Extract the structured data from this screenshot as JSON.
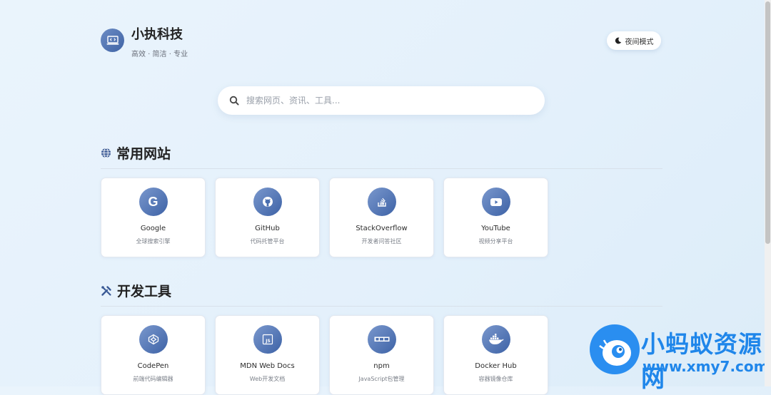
{
  "brand": {
    "title": "小执科技",
    "subtitle": "高效 · 简洁 · 专业"
  },
  "night_mode": {
    "label": "夜间模式"
  },
  "search": {
    "placeholder": "搜索网页、资讯、工具..."
  },
  "sections": [
    {
      "title": "常用网站",
      "icon": "globe-icon",
      "cards": [
        {
          "name": "Google",
          "desc": "全球搜索引擎",
          "icon": "google-icon"
        },
        {
          "name": "GitHub",
          "desc": "代码托管平台",
          "icon": "github-icon"
        },
        {
          "name": "StackOverflow",
          "desc": "开发者问答社区",
          "icon": "stackoverflow-icon"
        },
        {
          "name": "YouTube",
          "desc": "视频分享平台",
          "icon": "youtube-icon"
        }
      ]
    },
    {
      "title": "开发工具",
      "icon": "tools-icon",
      "cards": [
        {
          "name": "CodePen",
          "desc": "前端代码编辑器",
          "icon": "codepen-icon"
        },
        {
          "name": "MDN Web Docs",
          "desc": "Web开发文档",
          "icon": "js-icon"
        },
        {
          "name": "npm",
          "desc": "JavaScript包管理",
          "icon": "npm-icon"
        },
        {
          "name": "Docker Hub",
          "desc": "容器镜像仓库",
          "icon": "docker-icon"
        }
      ]
    }
  ],
  "watermark": {
    "title": "小蚂蚁资源网",
    "url": "www.xmy7.com"
  },
  "colors": {
    "accent": "#4a6fb0",
    "background": "#e6f2fc",
    "watermark": "#1f86ea"
  }
}
